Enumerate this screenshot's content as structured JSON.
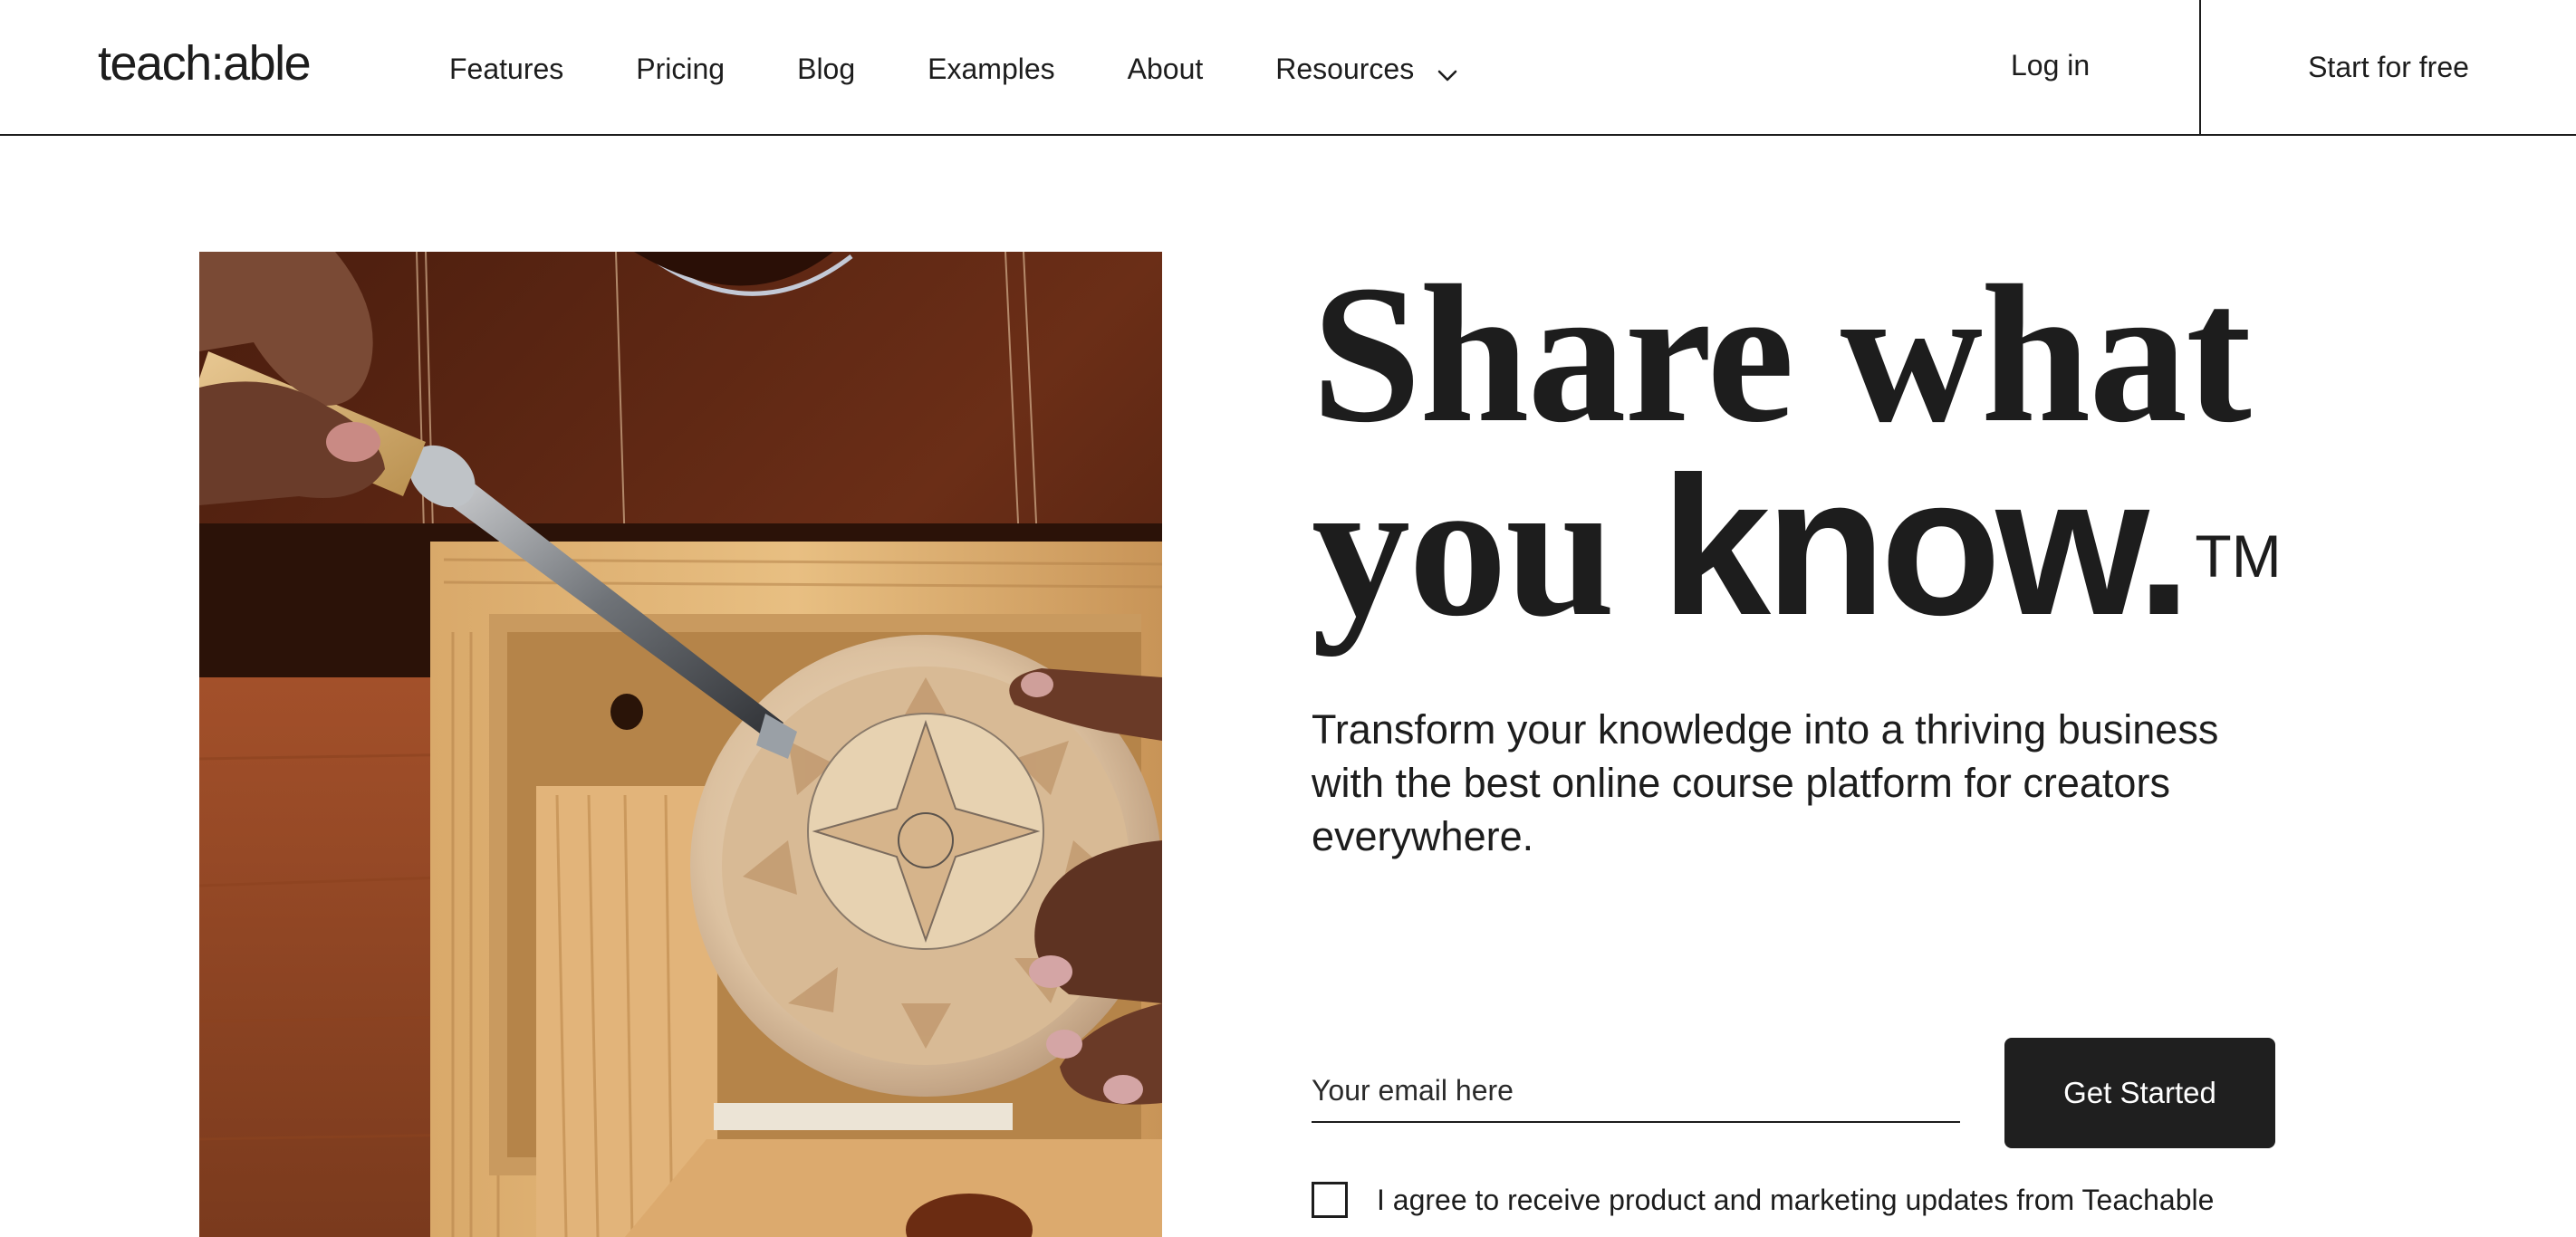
{
  "brand": {
    "logo_text": "teach:able"
  },
  "nav": {
    "links": [
      {
        "label": "Features"
      },
      {
        "label": "Pricing"
      },
      {
        "label": "Blog"
      },
      {
        "label": "Examples"
      },
      {
        "label": "About"
      },
      {
        "label": "Resources"
      }
    ],
    "resources_icon": "chevron-down-icon",
    "login_label": "Log in",
    "cta_label": "Start for free"
  },
  "hero": {
    "headline_line1": "Share what",
    "headline_line2_light": "you",
    "headline_line2_bold": "know.",
    "trademark": "TM",
    "subheadline": "Transform your knowledge into a thriving business with the best online course platform for creators everywhere.",
    "image_subject": "woodcarving-photo"
  },
  "signup": {
    "email_placeholder": "Your email here",
    "email_value": "",
    "button_label": "Get Started",
    "consent_label": "I agree to receive product and marketing updates from Teachable",
    "consent_checked": false
  },
  "colors": {
    "text": "#1d1d1d",
    "button_bg": "#1f1f1f",
    "button_text": "#ffffff",
    "background": "#ffffff"
  }
}
